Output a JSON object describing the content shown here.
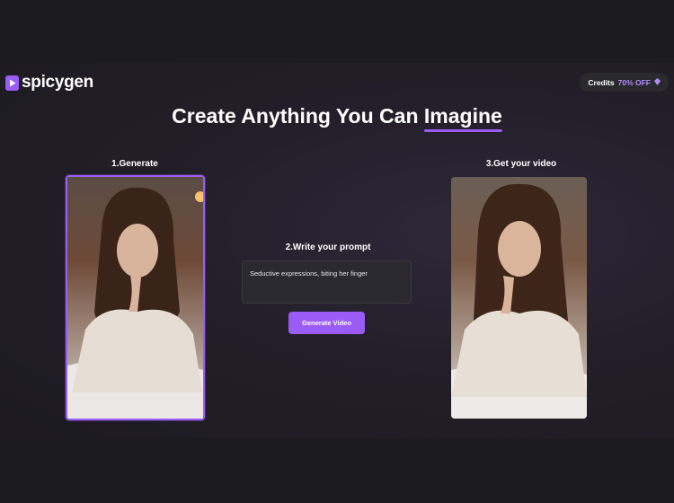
{
  "brand": {
    "name": "spicygen",
    "logo_icon": "play-icon"
  },
  "header": {
    "credits_label": "Credits",
    "credits_offer": "70% OFF",
    "credits_icon": "diamond-icon"
  },
  "hero": {
    "title_main": "Create Anything You Can",
    "title_accent": "Imagine"
  },
  "steps": {
    "generate": {
      "label": "1.Generate"
    },
    "prompt": {
      "label": "2.Write your prompt",
      "value": "Seductive expressions, biting her finger",
      "button_label": "Generate Video"
    },
    "video": {
      "label": "3.Get your video"
    }
  },
  "colors": {
    "accent": "#9b5cf6",
    "background": "#1c1b1f",
    "card": "#2b2930"
  }
}
